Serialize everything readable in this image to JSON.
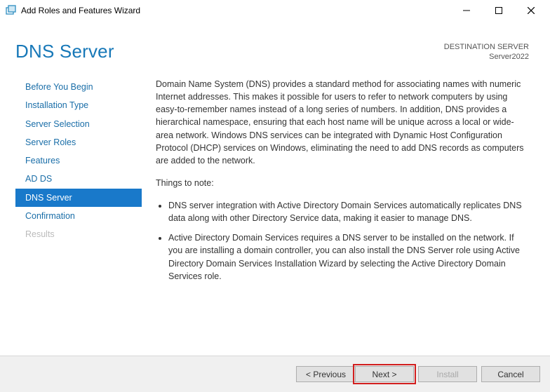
{
  "titlebar": {
    "title": "Add Roles and Features Wizard"
  },
  "header": {
    "page_title": "DNS Server",
    "destination_label": "DESTINATION SERVER",
    "destination_value": "Server2022"
  },
  "nav": {
    "items": [
      {
        "label": "Before You Begin",
        "state": "normal"
      },
      {
        "label": "Installation Type",
        "state": "normal"
      },
      {
        "label": "Server Selection",
        "state": "normal"
      },
      {
        "label": "Server Roles",
        "state": "normal"
      },
      {
        "label": "Features",
        "state": "normal"
      },
      {
        "label": "AD DS",
        "state": "normal"
      },
      {
        "label": "DNS Server",
        "state": "selected"
      },
      {
        "label": "Confirmation",
        "state": "normal"
      },
      {
        "label": "Results",
        "state": "disabled"
      }
    ]
  },
  "main": {
    "intro": "Domain Name System (DNS) provides a standard method for associating names with numeric Internet addresses. This makes it possible for users to refer to network computers by using easy-to-remember names instead of a long series of numbers. In addition, DNS provides a hierarchical namespace, ensuring that each host name will be unique across a local or wide-area network. Windows DNS services can be integrated with Dynamic Host Configuration Protocol (DHCP) services on Windows, eliminating the need to add DNS records as computers are added to the network.",
    "note_heading": "Things to note:",
    "bullets": [
      "DNS server integration with Active Directory Domain Services automatically replicates DNS data along with other Directory Service data, making it easier to manage DNS.",
      "Active Directory Domain Services requires a DNS server to be installed on the network. If you are installing a domain controller, you can also install the DNS Server role using Active Directory Domain Services Installation Wizard by selecting the Active Directory Domain Services role."
    ]
  },
  "footer": {
    "previous": "< Previous",
    "next": "Next >",
    "install": "Install",
    "cancel": "Cancel"
  }
}
